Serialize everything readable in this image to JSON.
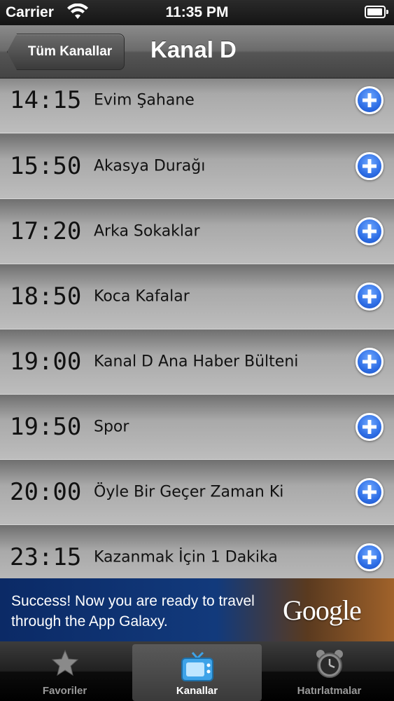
{
  "status_bar": {
    "carrier": "Carrier",
    "time": "11:35 PM",
    "battery_level": 0.95
  },
  "nav_bar": {
    "back_label": "Tüm Kanallar",
    "title": "Kanal D"
  },
  "schedule": [
    {
      "time": "14:15",
      "title": "Evim Şahane"
    },
    {
      "time": "15:50",
      "title": "Akasya Durağı"
    },
    {
      "time": "17:20",
      "title": "Arka Sokaklar"
    },
    {
      "time": "18:50",
      "title": "Koca Kafalar"
    },
    {
      "time": "19:00",
      "title": "Kanal D Ana Haber Bülteni"
    },
    {
      "time": "19:50",
      "title": "Spor"
    },
    {
      "time": "20:00",
      "title": "Öyle Bir Geçer Zaman Ki"
    },
    {
      "time": "23:15",
      "title": "Kazanmak İçin 1 Dakika"
    }
  ],
  "ad": {
    "text": "Success! Now you are ready to travel through the App Galaxy.",
    "logo": "Google"
  },
  "tabs": [
    {
      "label": "Favoriler",
      "icon": "star-icon",
      "selected": false
    },
    {
      "label": "Kanallar",
      "icon": "tv-icon",
      "selected": true
    },
    {
      "label": "Hatırlatmalar",
      "icon": "alarm-clock-icon",
      "selected": false
    }
  ],
  "colors": {
    "add_button": "#2f6fe6",
    "selected_tab_icon": "#3ea3e8"
  }
}
